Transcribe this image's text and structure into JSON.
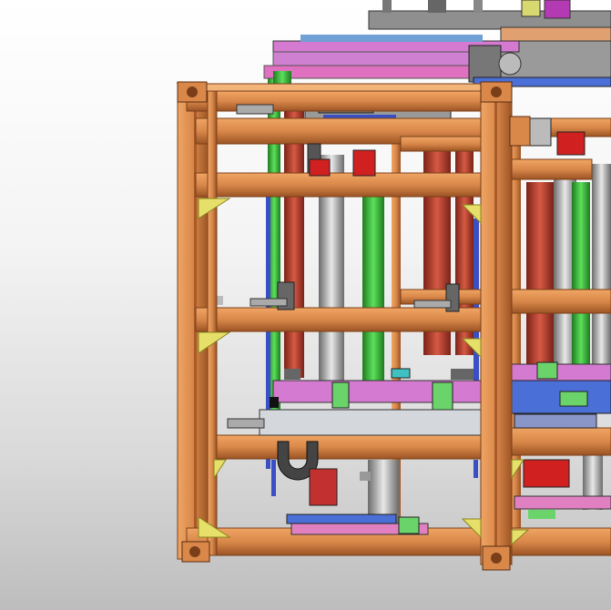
{
  "viewport": {
    "background_top": "#ffffff",
    "background_bottom": "#bdbdbd"
  },
  "model": {
    "frame_color": "#d9884a",
    "frame_shadow": "#a85a28",
    "gusset_color": "#e6e06a",
    "rod_green": "#43c443",
    "rod_red": "#c24a3a",
    "rod_blue": "#3a4fc4",
    "plate_pink": "#d47ad1",
    "plate_gray": "#9aa0a8",
    "plate_blue": "#4a6fd6"
  }
}
